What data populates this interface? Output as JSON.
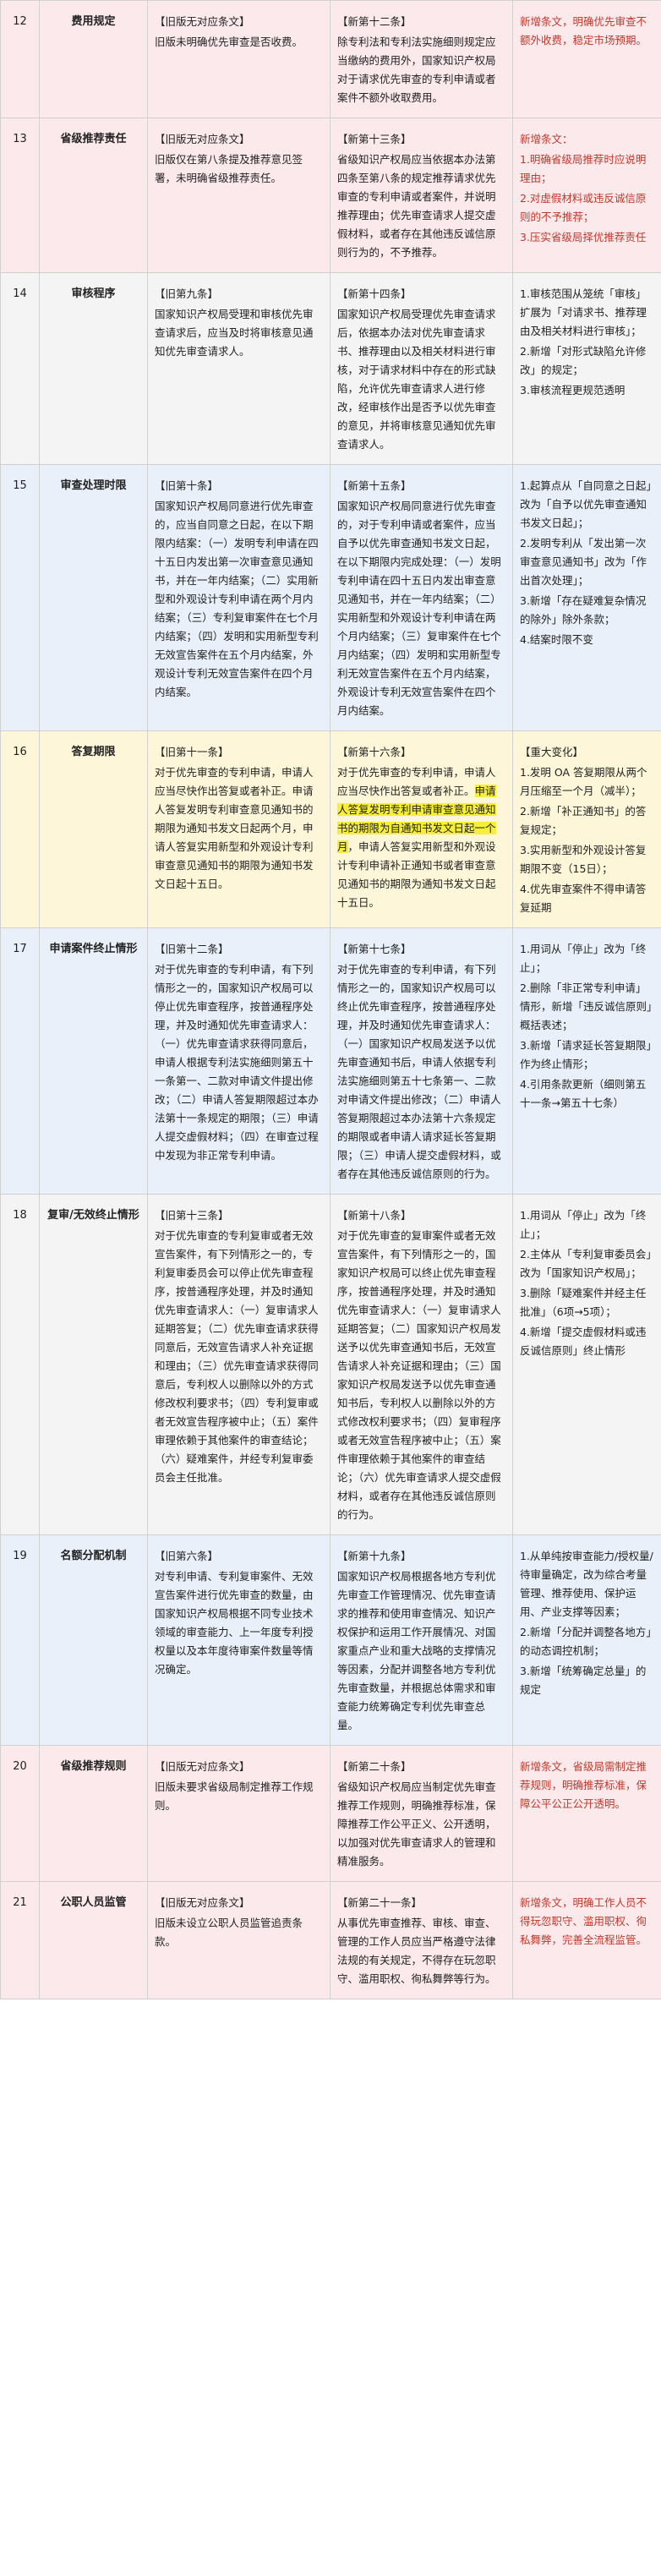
{
  "rows": [
    {
      "num": "12",
      "topic": "费用规定",
      "tint": "pink",
      "note_red": true,
      "old": [
        "【旧版无对应条文】",
        "旧版未明确优先审查是否收费。"
      ],
      "new": [
        "【新第十二条】",
        "除专利法和专利法实施细则规定应当缴纳的费用外，国家知识产权局对于请求优先审查的专利申请或者案件不额外收取费用。"
      ],
      "note": [
        "新增条文，明确优先审查不额外收费，稳定市场预期。"
      ]
    },
    {
      "num": "13",
      "topic": "省级推荐责任",
      "tint": "pink",
      "note_red": true,
      "old": [
        "【旧版无对应条文】",
        "旧版仅在第八条提及推荐意见签署，未明确省级推荐责任。"
      ],
      "new": [
        "【新第十三条】",
        "省级知识产权局应当依据本办法第四条至第八条的规定推荐请求优先审查的专利申请或者案件，并说明推荐理由；优先审查请求人提交虚假材料，或者存在其他违反诚信原则行为的，不予推荐。"
      ],
      "note": [
        "新增条文：",
        "1.明确省级局推荐时应说明理由；",
        "2.对虚假材料或违反诚信原则的不予推荐；",
        "3.压实省级局择优推荐责任"
      ]
    },
    {
      "num": "14",
      "topic": "审核程序",
      "tint": "grey",
      "note_red": false,
      "old": [
        "【旧第九条】",
        "国家知识产权局受理和审核优先审查请求后，应当及时将审核意见通知优先审查请求人。"
      ],
      "new": [
        "【新第十四条】",
        "国家知识产权局受理优先审查请求后，依据本办法对优先审查请求书、推荐理由以及相关材料进行审核，对于请求材料中存在的形式缺陷，允许优先审查请求人进行修改，经审核作出是否予以优先审查的意见，并将审核意见通知优先审查请求人。"
      ],
      "note": [
        "1.审核范围从笼统「审核」扩展为「对请求书、推荐理由及相关材料进行审核」；",
        "2.新增「对形式缺陷允许修改」的规定；",
        "3.审核流程更规范透明"
      ]
    },
    {
      "num": "15",
      "topic": "审查处理时限",
      "tint": "blue",
      "note_red": false,
      "old": [
        "【旧第十条】",
        "国家知识产权局同意进行优先审查的，应当自同意之日起，在以下期限内结案：（一）发明专利申请在四十五日内发出第一次审查意见通知书，并在一年内结案；（二）实用新型和外观设计专利申请在两个月内结案；（三）专利复审案件在七个月内结案；（四）发明和实用新型专利无效宣告案件在五个月内结案，外观设计专利无效宣告案件在四个月内结案。"
      ],
      "new": [
        "【新第十五条】",
        "国家知识产权局同意进行优先审查的，对于专利申请或者案件，应当自予以优先审查通知书发文日起，在以下期限内完成处理：（一）发明专利申请在四十五日内发出审查意见通知书，并在一年内结案；（二）实用新型和外观设计专利申请在两个月内结案；（三）复审案件在七个月内结案；（四）发明和实用新型专利无效宣告案件在五个月内结案，外观设计专利无效宣告案件在四个月内结案。"
      ],
      "note": [
        "1.起算点从「自同意之日起」改为「自予以优先审查通知书发文日起」；",
        "2.发明专利从「发出第一次审查意见通知书」改为「作出首次处理」；",
        "3.新增「存在疑难复杂情况的除外」除外条款；",
        "4.结案时限不变"
      ]
    },
    {
      "num": "16",
      "topic": "答复期限",
      "tint": "yellow",
      "note_red": false,
      "old": [
        "【旧第十一条】",
        "对于优先审查的专利申请，申请人应当尽快作出答复或者补正。申请人答复发明专利审查意见通知书的期限为通知书发文日起两个月，申请人答复实用新型和外观设计专利审查意见通知书的期限为通知书发文日起十五日。"
      ],
      "new": [
        "【新第十六条】",
        "对于优先审查的专利申请，申请人应当尽快作出答复或者补正。",
        "申请人答复发明专利申请审查意见通知书的期限为自通知书发文日起一个月",
        "，申请人答复实用新型和外观设计专利申请补正通知书或者审查意见通知书的期限为通知书发文日起十五日。"
      ],
      "note": [
        "【重大变化】",
        "1.发明 OA 答复期限从两个月压缩至一个月（减半）；",
        "2.新增「补正通知书」的答复规定；",
        "3.实用新型和外观设计答复期限不变（15日）；",
        "4.优先审查案件不得申请答复延期"
      ]
    },
    {
      "num": "17",
      "topic": "申请案件终止情形",
      "tint": "blue",
      "note_red": false,
      "old": [
        "【旧第十二条】",
        "对于优先审查的专利申请，有下列情形之一的，国家知识产权局可以停止优先审查程序，按普通程序处理，并及时通知优先审查请求人：（一）优先审查请求获得同意后，申请人根据专利法实施细则第五十一条第一、二款对申请文件提出修改；（二）申请人答复期限超过本办法第十一条规定的期限；（三）申请人提交虚假材料；（四）在审查过程中发现为非正常专利申请。"
      ],
      "new": [
        "【新第十七条】",
        "对于优先审查的专利申请，有下列情形之一的，国家知识产权局可以终止优先审查程序，按普通程序处理，并及时通知优先审查请求人：（一）国家知识产权局发送予以优先审查通知书后，申请人依据专利法实施细则第五十七条第一、二款对申请文件提出修改；（二）申请人答复期限超过本办法第十六条规定的期限或者申请人请求延长答复期限；（三）申请人提交虚假材料，或者存在其他违反诚信原则的行为。"
      ],
      "note": [
        "1.用词从「停止」改为「终止」；",
        "2.删除「非正常专利申请」情形，新增「违反诚信原则」概括表述；",
        "3.新增「请求延长答复期限」作为终止情形；",
        "4.引用条款更新（细则第五十一条→第五十七条）"
      ]
    },
    {
      "num": "18",
      "topic": "复审/无效终止情形",
      "tint": "grey",
      "note_red": false,
      "old": [
        "【旧第十三条】",
        "对于优先审查的专利复审或者无效宣告案件，有下列情形之一的，专利复审委员会可以停止优先审查程序，按普通程序处理，并及时通知优先审查请求人：（一）复审请求人延期答复；（二）优先审查请求获得同意后，无效宣告请求人补充证据和理由；（三）优先审查请求获得同意后，专利权人以删除以外的方式修改权利要求书；（四）专利复审或者无效宣告程序被中止；（五）案件审理依赖于其他案件的审查结论；（六）疑难案件，并经专利复审委员会主任批准。"
      ],
      "new": [
        "【新第十八条】",
        "对于优先审查的复审案件或者无效宣告案件，有下列情形之一的，国家知识产权局可以终止优先审查程序，按普通程序处理，并及时通知优先审查请求人：（一）复审请求人延期答复；（二）国家知识产权局发送予以优先审查通知书后，无效宣告请求人补充证据和理由；（三）国家知识产权局发送予以优先审查通知书后，专利权人以删除以外的方式修改权利要求书；（四）复审程序或者无效宣告程序被中止；（五）案件审理依赖于其他案件的审查结论；（六）优先审查请求人提交虚假材料，或者存在其他违反诚信原则的行为。"
      ],
      "note": [
        "1.用词从「停止」改为「终止」；",
        "2.主体从「专利复审委员会」改为「国家知识产权局」；",
        "3.删除「疑难案件并经主任批准」（6项→5项）；",
        "4.新增「提交虚假材料或违反诚信原则」终止情形"
      ]
    },
    {
      "num": "19",
      "topic": "名额分配机制",
      "tint": "blue",
      "note_red": false,
      "old": [
        "【旧第六条】",
        "对专利申请、专利复审案件、无效宣告案件进行优先审查的数量，由国家知识产权局根据不同专业技术领域的审查能力、上一年度专利授权量以及本年度待审案件数量等情况确定。"
      ],
      "new": [
        "【新第十九条】",
        "国家知识产权局根据各地方专利优先审查工作管理情况、优先审查请求的推荐和使用审查情况、知识产权保护和运用工作开展情况、对国家重点产业和重大战略的支撑情况等因素，分配并调整各地方专利优先审查数量，并根据总体需求和审查能力统筹确定专利优先审查总量。"
      ],
      "note": [
        "1.从单纯按审查能力/授权量/待审量确定，改为综合考量管理、推荐使用、保护运用、产业支撑等因素；",
        "2.新增「分配并调整各地方」的动态调控机制；",
        "3.新增「统筹确定总量」的规定"
      ]
    },
    {
      "num": "20",
      "topic": "省级推荐规则",
      "tint": "pink",
      "note_red": true,
      "old": [
        "【旧版无对应条文】",
        "旧版未要求省级局制定推荐工作规则。"
      ],
      "new": [
        "【新第二十条】",
        "省级知识产权局应当制定优先审查推荐工作规则，明确推荐标准，保障推荐工作公平正义、公开透明，以加强对优先审查请求人的管理和精准服务。"
      ],
      "note": [
        "新增条文，省级局需制定推荐规则，明确推荐标准，保障公平公正公开透明。"
      ]
    },
    {
      "num": "21",
      "topic": "公职人员监管",
      "tint": "pink",
      "note_red": true,
      "old": [
        "【旧版无对应条文】",
        "旧版未设立公职人员监管追责条款。"
      ],
      "new": [
        "【新第二十一条】",
        "从事优先审查推荐、审核、审查、管理的工作人员应当严格遵守法律法规的有关规定，不得存在玩忽职守、滥用职权、徇私舞弊等行为。"
      ],
      "note": [
        "新增条文，明确工作人员不得玩忽职守、滥用职权、徇私舞弊，完善全流程监管。"
      ]
    }
  ]
}
